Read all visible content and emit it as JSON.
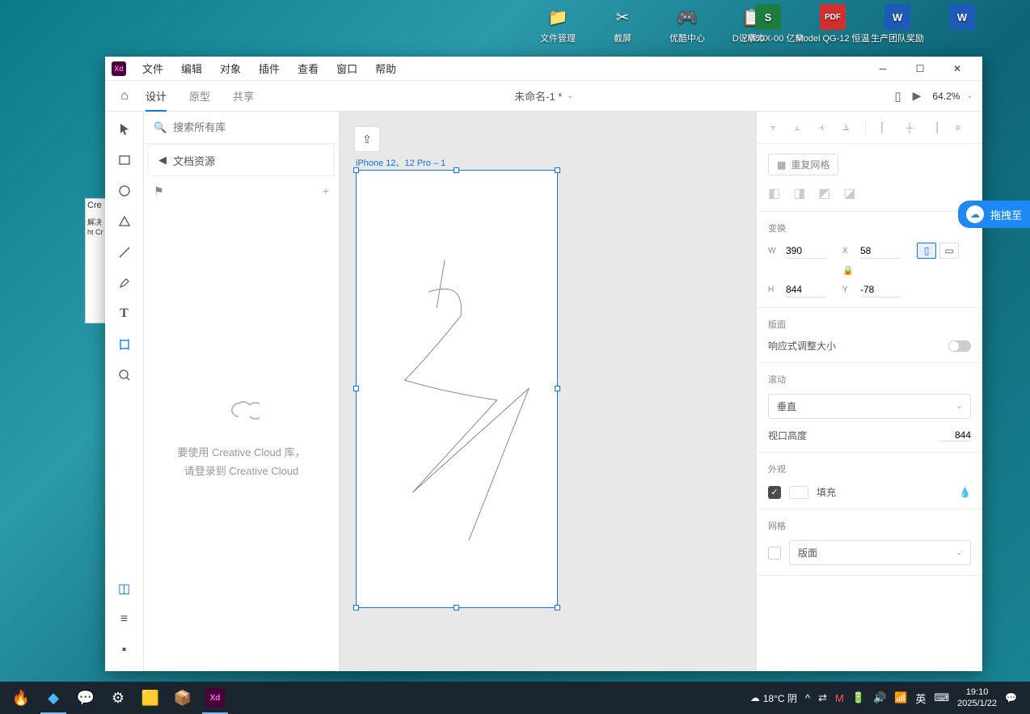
{
  "desktop": {
    "row1": [
      {
        "icon": "📁",
        "label": "文件管理"
      },
      {
        "icon": "✂",
        "label": "截屏"
      },
      {
        "icon": "🎮",
        "label": "优酷中心"
      },
      {
        "icon": "📋",
        "label": "记事本"
      }
    ],
    "row2": [
      {
        "box": "S",
        "bg": "#1e7c3e",
        "label": "D·YM50X-00 亿柴"
      },
      {
        "box": "PDF",
        "bg": "#d32f2f",
        "label": "Model QG-12 恒温"
      },
      {
        "box": "W",
        "bg": "#1e5bb8",
        "label": "生产团队奖励"
      },
      {
        "box": "W",
        "bg": "#1e5bb8",
        "label": ""
      }
    ]
  },
  "partial": {
    "title": "Cre",
    "body": "解决 ht Cr"
  },
  "menu": {
    "file": "文件",
    "edit": "编辑",
    "object": "对象",
    "plugins": "插件",
    "view": "查看",
    "window": "窗口",
    "help": "帮助"
  },
  "tabs": {
    "design": "设计",
    "prototype": "原型",
    "share": "共享"
  },
  "document": {
    "name": "未命名-1 *"
  },
  "zoom": "64.2%",
  "leftPanel": {
    "searchPlaceholder": "搜索所有库",
    "assets": "文档资源",
    "ccLine1": "要使用 Creative Cloud 库，",
    "ccLine2": "请登录到 Creative Cloud"
  },
  "artboard": {
    "label": "iPhone 12、12 Pro – 1"
  },
  "rightPanel": {
    "repeatGrid": "重复网格",
    "transform": "变换",
    "W": "390",
    "X": "58",
    "H": "844",
    "Y": "-78",
    "layout": "版面",
    "responsive": "响应式调整大小",
    "scroll": "滚动",
    "scrollValue": "垂直",
    "viewportHeight": "视口高度",
    "viewportValue": "844",
    "appearance": "外观",
    "fill": "填充",
    "grid": "网格",
    "gridValue": "版面"
  },
  "baidu": "拖拽至",
  "taskbar": {
    "weather": "18°C 阴",
    "ime": "英",
    "time": "19:10",
    "date": "2025/1/22"
  }
}
